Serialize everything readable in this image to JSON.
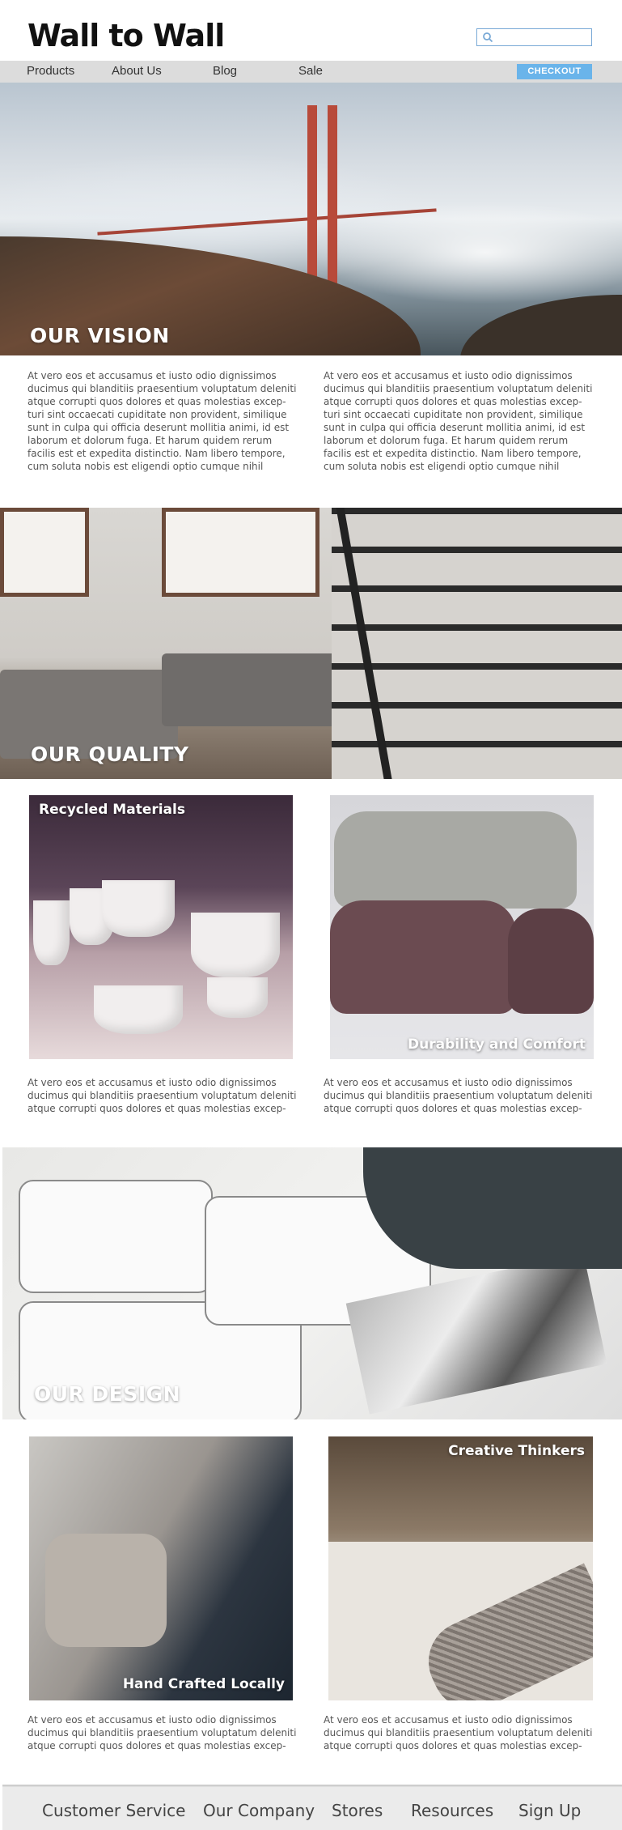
{
  "header": {
    "logo": "Wall to Wall",
    "search": {
      "placeholder": "",
      "value": ""
    }
  },
  "nav": {
    "items": [
      "Products",
      "About Us",
      "Blog",
      "Sale"
    ],
    "checkout_label": "CHECKOUT"
  },
  "sections": {
    "vision": {
      "heading": "OUR VISION",
      "paragraphs": [
        "At vero eos et accusamus et iusto odio dignissimos ducimus qui blanditiis praesentium voluptatum deleniti atque corrupti quos dolores et quas molestias excep- turi sint occaecati cupiditate non provident, similique sunt in culpa qui officia deserunt mollitia animi, id est laborum et dolorum fuga. Et harum quidem rerum facilis est et expedita distinctio. Nam libero tempore, cum soluta nobis est eligendi optio cumque nihil",
        "At vero eos et accusamus et iusto odio dignissimos ducimus qui blanditiis praesentium voluptatum deleniti atque corrupti quos dolores et quas molestias excep- turi sint occaecati cupiditate non provident, similique sunt in culpa qui officia deserunt mollitia animi, id est laborum et dolorum fuga. Et harum quidem rerum facilis est et expedita distinctio. Nam libero tempore, cum soluta nobis est eligendi optio cumque nihil"
      ]
    },
    "quality": {
      "heading": "OUR QUALITY",
      "tiles": [
        {
          "label": "Recycled Materials",
          "text": "At vero eos et accusamus et iusto odio dignissimos ducimus qui blanditiis praesentium voluptatum deleniti atque corrupti quos dolores et quas molestias excep-"
        },
        {
          "label": "Durability and Comfort",
          "text": "At vero eos et accusamus et iusto odio dignissimos ducimus qui blanditiis praesentium voluptatum deleniti atque corrupti quos dolores et quas molestias excep-"
        }
      ]
    },
    "design": {
      "heading": "OUR DESIGN",
      "tiles": [
        {
          "label": "Hand Crafted Locally",
          "text": "At vero eos et accusamus et iusto odio dignissimos ducimus qui blanditiis praesentium voluptatum deleniti atque corrupti quos dolores et quas molestias excep-"
        },
        {
          "label": "Creative Thinkers",
          "text": "At vero eos et accusamus et iusto odio dignissimos ducimus qui blanditiis praesentium voluptatum deleniti atque corrupti quos dolores et quas molestias excep-"
        }
      ]
    }
  },
  "footer": {
    "links": [
      "Customer Service",
      "Our Company",
      "Stores",
      "Resources",
      "Sign Up"
    ]
  },
  "colors": {
    "accent": "#6ab4ea",
    "nav_bg": "#dcdcdc",
    "search_border": "#79a9d6"
  },
  "icons": [
    "search-icon"
  ]
}
